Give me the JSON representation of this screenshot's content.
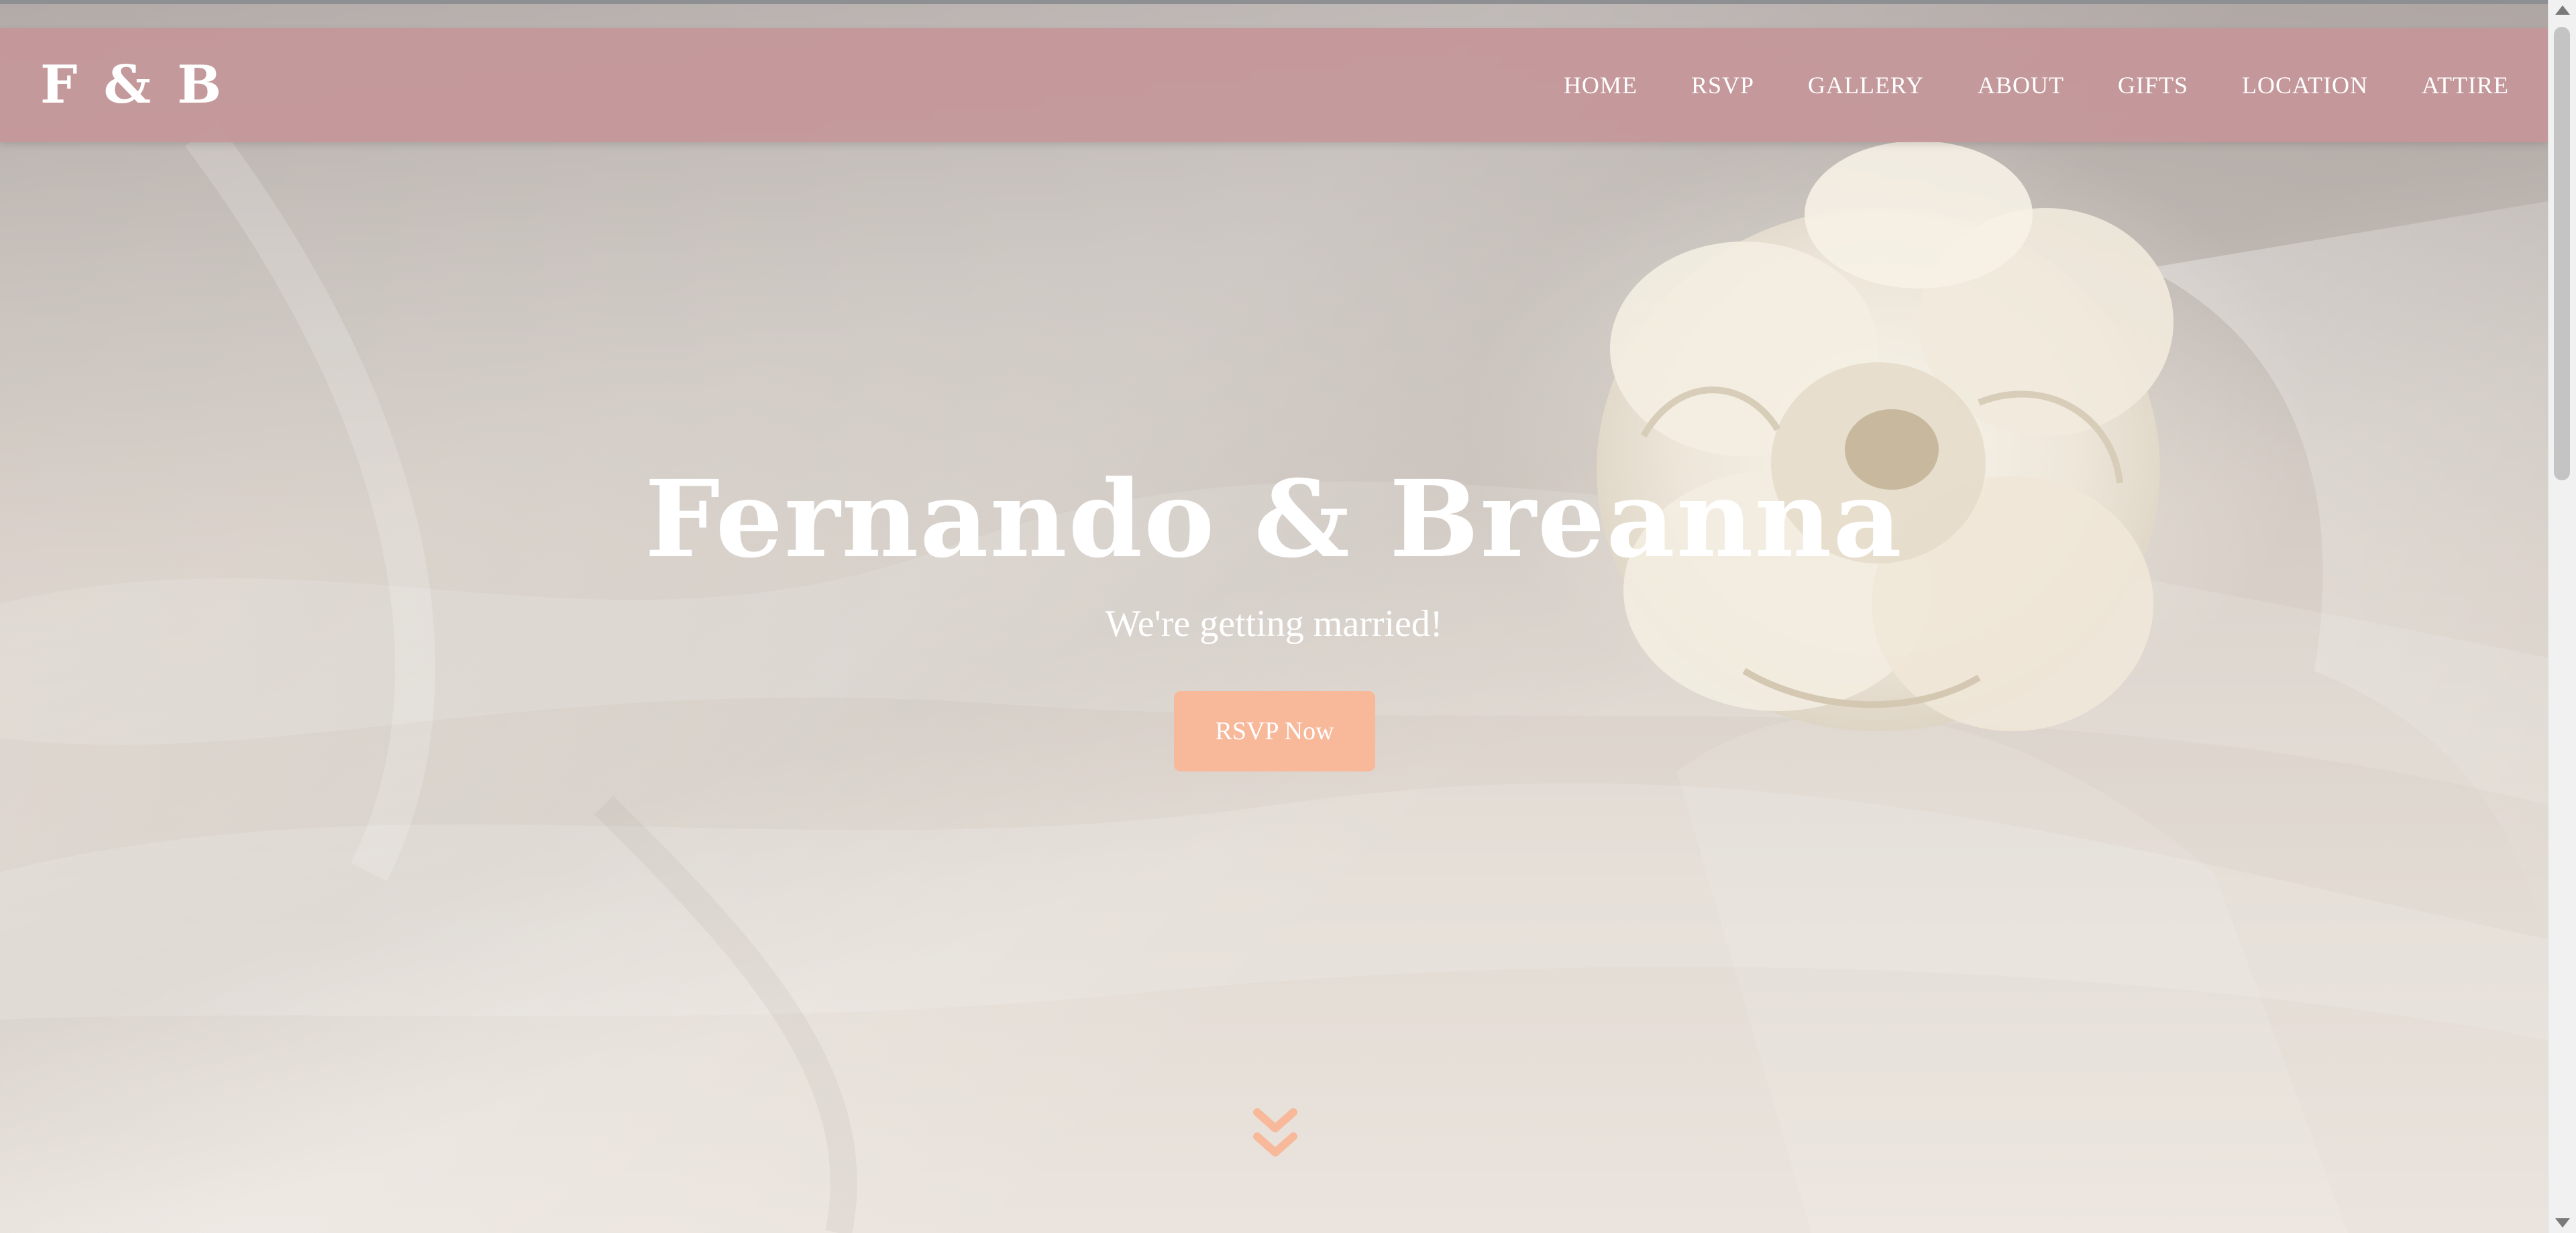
{
  "brand": {
    "logo_text": "F & B"
  },
  "nav": {
    "items": [
      {
        "label": "HOME"
      },
      {
        "label": "RSVP"
      },
      {
        "label": "GALLERY"
      },
      {
        "label": "ABOUT"
      },
      {
        "label": "GIFTS"
      },
      {
        "label": "LOCATION"
      },
      {
        "label": "ATTIRE"
      }
    ]
  },
  "hero": {
    "title": "Fernando & Breanna",
    "subtitle": "We're getting married!",
    "cta_label": "RSVP Now",
    "scroll_icon": "double-chevron-down-icon",
    "background_image": "white-flower-on-draped-fabric"
  },
  "colors": {
    "navbar": "#c5979a",
    "accent": "#f8b89a",
    "text_on_dark": "#ffffff"
  }
}
